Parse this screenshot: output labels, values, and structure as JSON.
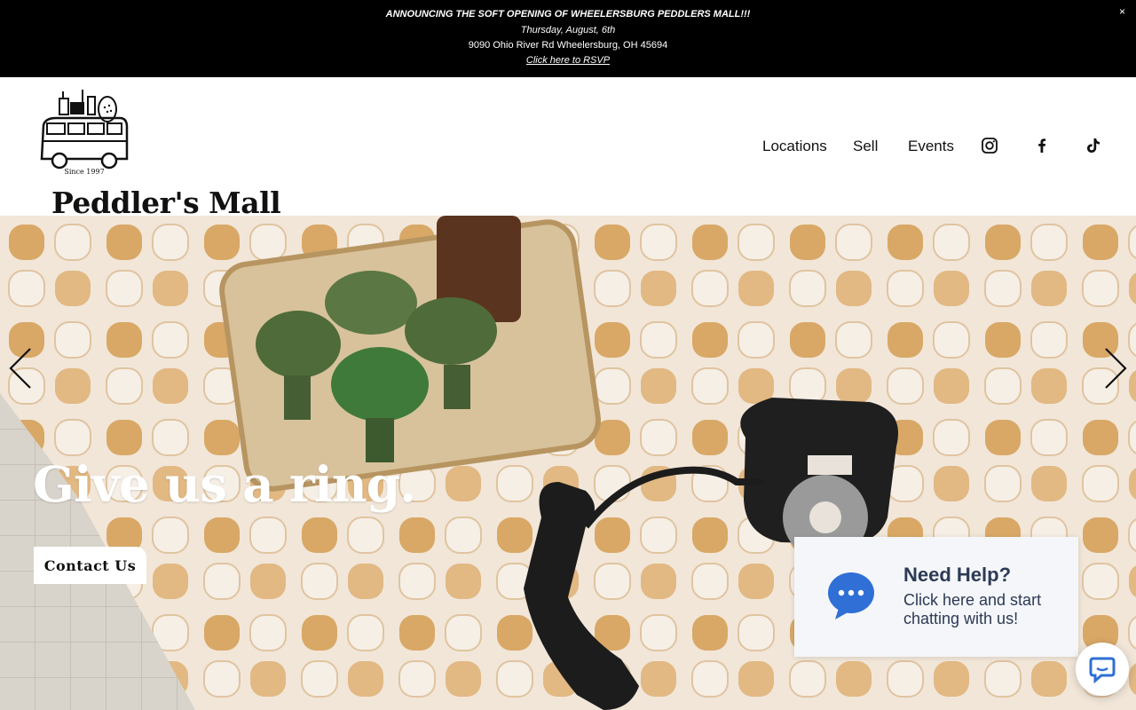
{
  "announcement": {
    "headline": "ANNOUNCING THE SOFT OPENING OF WHEELERSBURG PEDDLERS MALL!!!",
    "date": "Thursday, August, 6th",
    "address": "9090 Ohio River Rd Wheelersburg, OH 45694",
    "rsvp_link": "Click here to RSVP",
    "close_label": "×"
  },
  "header": {
    "logo_caption": "Since 1997",
    "brand": "Peddler's Mall",
    "nav": [
      {
        "label": "Locations"
      },
      {
        "label": "Sell"
      },
      {
        "label": "Events"
      }
    ],
    "social_icons": [
      "instagram-icon",
      "facebook-icon",
      "tiktok-icon"
    ]
  },
  "hero": {
    "heading": "Give us a ring.",
    "cta_label": "Contact Us",
    "image_subject": "vintage rotary phone and green glass cups on retro patterned couch"
  },
  "chat": {
    "title": "Need Help?",
    "subtitle": "Click here and start chatting with us!",
    "accent_color": "#2f6fd6"
  },
  "colors": {
    "announcement_bg": "#000000",
    "text": "#111111",
    "chat_text": "#2d3a55"
  }
}
